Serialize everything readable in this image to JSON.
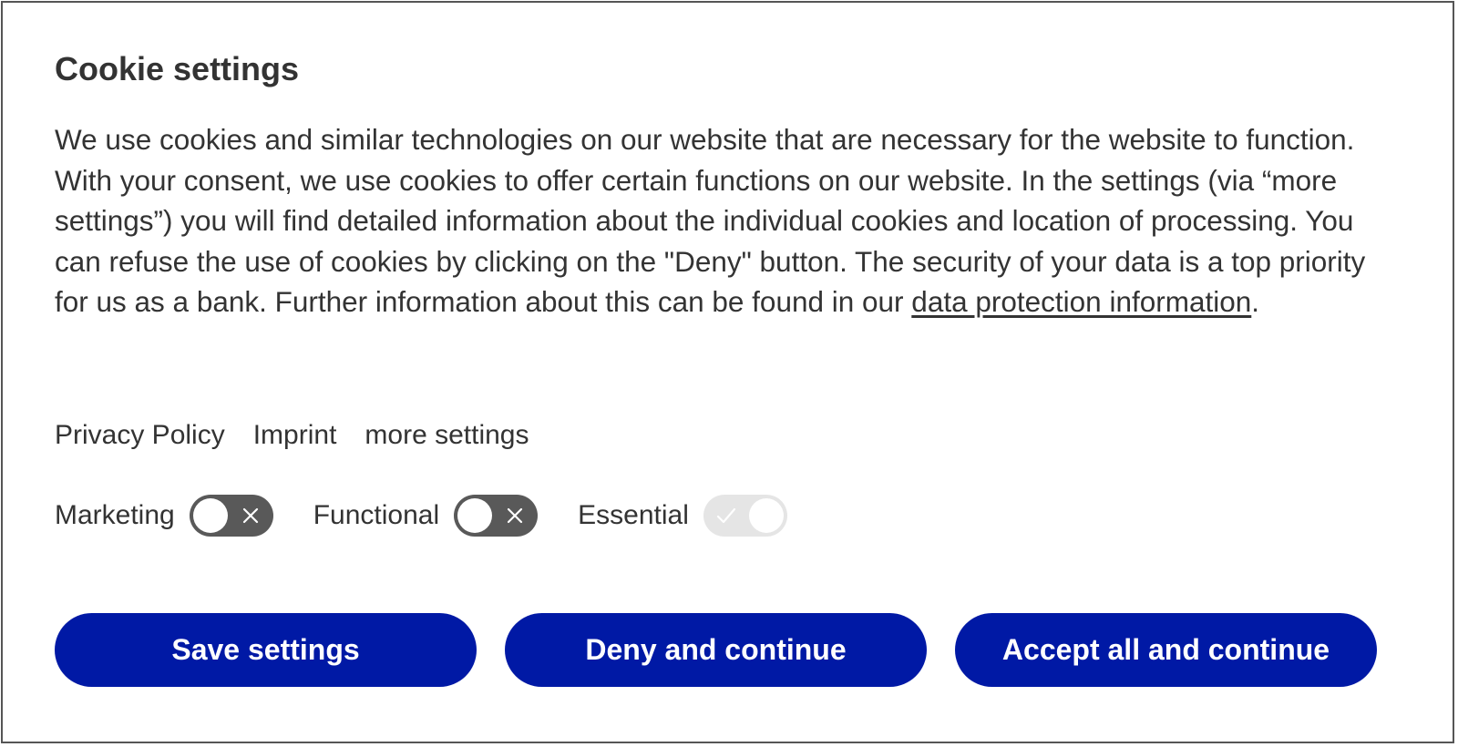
{
  "dialog": {
    "title": "Cookie settings",
    "description_before_link": "We use cookies and similar technologies on our website that are necessary for the website to function. With your consent, we use cookies to offer certain functions on our website. In the settings (via “more settings”) you will find detailed information about the individual cookies and location of processing. You can refuse the use of cookies by clicking on the \"Deny\" button. The security of your data is a top priority for us as a bank. Further information about this can be found in our ",
    "description_link": "data protection information",
    "description_after_link": "."
  },
  "links": {
    "privacy_policy": "Privacy Policy",
    "imprint": "Imprint",
    "more_settings": "more settings"
  },
  "toggles": [
    {
      "label": "Marketing",
      "state": "off",
      "icon": "x-icon"
    },
    {
      "label": "Functional",
      "state": "off",
      "icon": "x-icon"
    },
    {
      "label": "Essential",
      "state": "on-disabled",
      "icon": "check-icon"
    }
  ],
  "buttons": {
    "save": "Save settings",
    "deny": "Deny and continue",
    "accept": "Accept all and continue"
  },
  "colors": {
    "primary": "#0019a5",
    "toggle_off": "#595959",
    "toggle_disabled": "#e5e5e5",
    "text": "#333333"
  }
}
